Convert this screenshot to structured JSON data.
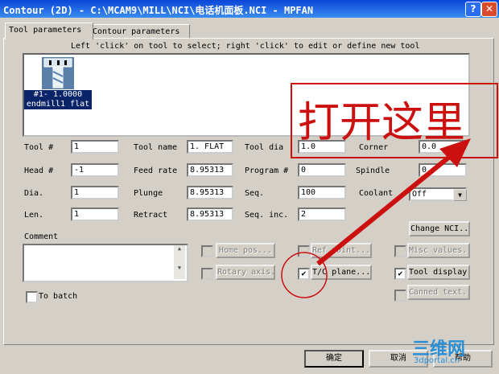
{
  "window": {
    "title": "Contour (2D) - C:\\MCAM9\\MILL\\NCI\\电话机面板.NCI - MPFAN",
    "help_btn": "?",
    "close_btn": "✕"
  },
  "tabs": [
    "Tool parameters",
    "Contour parameters"
  ],
  "tool_list": {
    "hint": "Left 'click' on tool to select; right 'click' to edit or define new tool",
    "tool_line1": "#1- 1.0000",
    "tool_line2": "endmill1 flat"
  },
  "fields": {
    "tool_num": {
      "label": "Tool #",
      "value": "1"
    },
    "head_num": {
      "label": "Head #",
      "value": "-1"
    },
    "dia": {
      "label": "Dia.",
      "value": "1"
    },
    "len": {
      "label": "Len.",
      "value": "1"
    },
    "tool_name": {
      "label": "Tool name",
      "value": "1. FLAT"
    },
    "feed_rate": {
      "label": "Feed rate",
      "value": "8.95313"
    },
    "plunge": {
      "label": "Plunge",
      "value": "8.95313"
    },
    "retract": {
      "label": "Retract",
      "value": "8.95313"
    },
    "tool_dia": {
      "label": "Tool dia",
      "value": "1.0"
    },
    "program_num": {
      "label": "Program #",
      "value": "0"
    },
    "seq": {
      "label": "Seq.",
      "value": "100"
    },
    "seq_inc": {
      "label": "Seq. inc.",
      "value": "2"
    },
    "corner": {
      "label": "Corner",
      "value": "0.0"
    },
    "spindle": {
      "label": "Spindle",
      "value": "0"
    },
    "coolant": {
      "label": "Coolant",
      "value": "Off"
    }
  },
  "comment_label": "Comment",
  "to_batch_label": "To batch",
  "buttons": {
    "change_nci": "Change NCI...",
    "home_pos": "Home pos...",
    "ref_point": "Ref point...",
    "misc_values": "Misc values...",
    "rotary_axis": "Rotary axis...",
    "tc_plane": "T/C plane...",
    "tool_display": "Tool display...",
    "canned_text": "Canned text...",
    "ok": "确定",
    "cancel": "取消",
    "help": "帮助"
  },
  "annotation_text": "打开这里",
  "brand": {
    "main": "三维网",
    "sub": "3dportal.cn"
  },
  "colors": {
    "annotation": "#cc1010",
    "brand": "#2a8fd6",
    "title_bar": "#0a46d8"
  }
}
